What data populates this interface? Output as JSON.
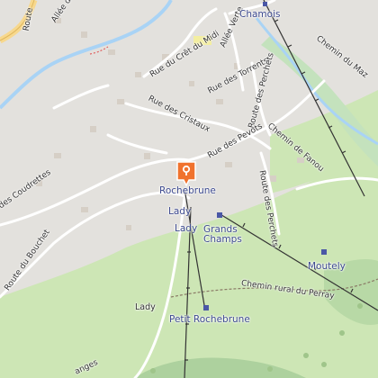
{
  "map": {
    "places": {
      "chamois": "Chamois",
      "rochebrune": "Rochebrune",
      "lady_top": "Lady",
      "lady_small": "Lady",
      "grands_champs": "Grands\nChamps",
      "moutely": "Moutely",
      "lady_bottom": "Lady",
      "petit_rochebrune": "Petit Rochebrune"
    },
    "roads": {
      "route_top_left": "Route",
      "allee_des": "Allée des",
      "allee_verte": "Allée Verte",
      "rue_cret_du_midi": "Rue du Crêt du Midi",
      "rue_des_torrents": "Rue des Torrents",
      "rue_des_cristaux": "Rue des Cristaux",
      "route_des_perchets_top": "Route des Perchets",
      "rue_des_pevots": "Rue des Pevots",
      "chemin_de_fanou": "Chemin de Fanou",
      "chemin_du_maz": "Chemin du Maz",
      "route_des_perchets_bottom": "Route des Perchets",
      "des_coudrettes": "des Coudrettes",
      "route_du_bouchet": "Route du Bouchet",
      "chemin_rural": "Chemin rural du Perray",
      "anges": "anges"
    },
    "colors": {
      "background": "#e3e1dd",
      "meadow": "#cde6b5",
      "forest": "#add19e",
      "river": "#a9d3f5",
      "road_major": "#f7d88e",
      "marker": "#f0722d",
      "place_text": "#3d4a8f"
    },
    "marker_icon": "map-pin-icon"
  }
}
